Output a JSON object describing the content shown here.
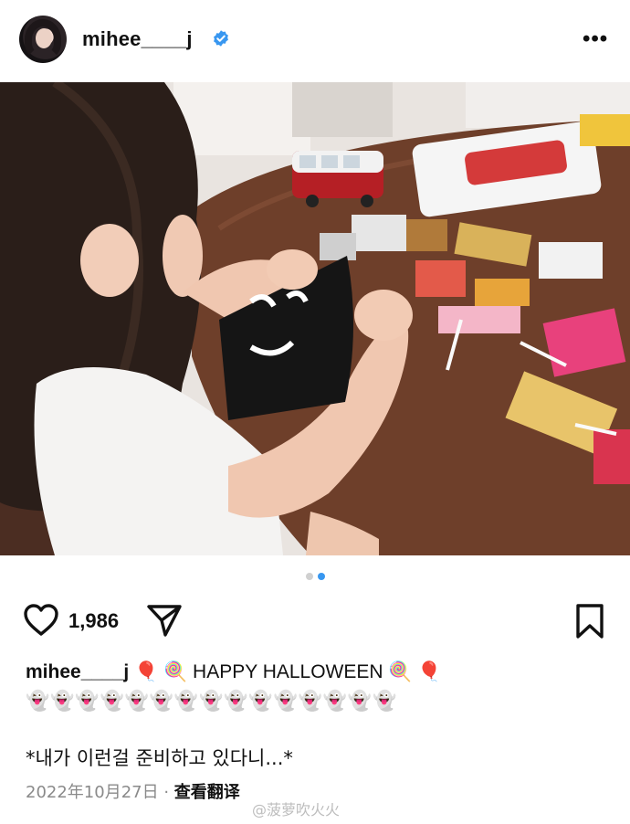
{
  "post": {
    "username": "mihee____j",
    "more_icon": "more-dots-icon",
    "verified_icon": "verified-badge-icon"
  },
  "carousel": {
    "count": 2,
    "active_index": 1
  },
  "actions": {
    "likes": "1,986",
    "like_icon": "heart-icon",
    "share_icon": "send-icon",
    "save_icon": "bookmark-icon"
  },
  "caption": {
    "username": "mihee____j",
    "text": " 🎈 🍭 HAPPY HALLOWEEN 🍭 🎈",
    "emojis": "👻👻👻👻👻👻👻👻👻👻👻👻👻👻👻",
    "note": "*내가 이런걸 준비하고 있다니...*"
  },
  "footer": {
    "date": "2022年10月27日",
    "separator": " · ",
    "translate_label": "查看翻译"
  },
  "watermark": "@菠萝吹火火",
  "colors": {
    "accent": "#3897f0",
    "muted": "#8a8a8a",
    "table": "#6e3f2a"
  }
}
